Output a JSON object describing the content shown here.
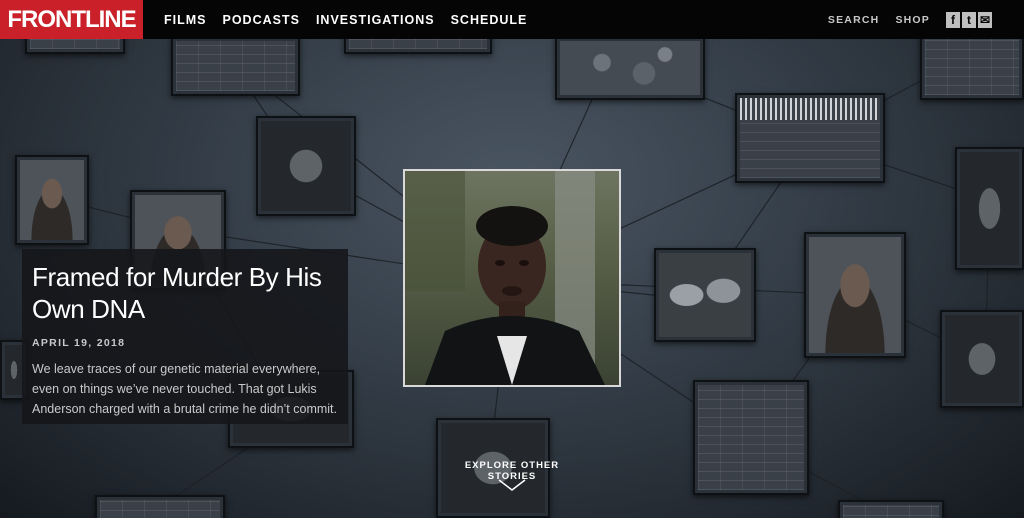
{
  "nav": {
    "logo": "FRONTLINE",
    "menu": [
      {
        "label": "FILMS"
      },
      {
        "label": "PODCASTS"
      },
      {
        "label": "INVESTIGATIONS"
      },
      {
        "label": "SCHEDULE"
      }
    ],
    "search_label": "SEARCH",
    "shop_label": "SHOP",
    "social": [
      {
        "icon": "facebook-icon",
        "glyph": "f"
      },
      {
        "icon": "twitter-icon",
        "glyph": "t"
      },
      {
        "icon": "email-icon",
        "glyph": "✉"
      }
    ]
  },
  "story": {
    "title": "Framed for Murder By His Own DNA",
    "date": "APRIL 19, 2018",
    "description": "We leave traces of our genetic material everywhere, even on things we’ve never touched. That got Lukis Anderson charged with a brutal crime he didn’t commit."
  },
  "explore": {
    "label": "EXPLORE OTHER STORIES"
  },
  "colors": {
    "brand_red": "#c9202a",
    "nav_bg": "#050505"
  }
}
